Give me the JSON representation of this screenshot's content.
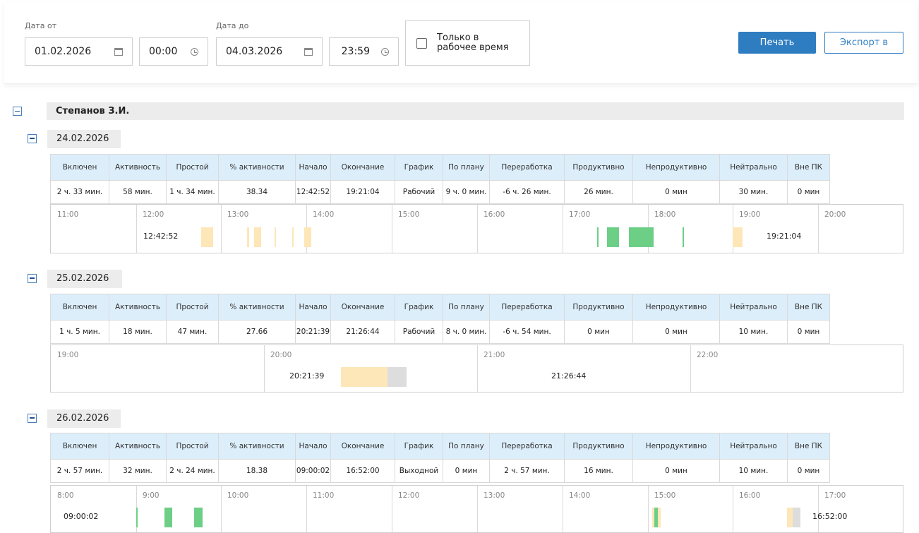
{
  "filters": {
    "date_from_label": "Дата от",
    "date_from": "01.02.2026",
    "time_from": "00:00",
    "date_to_label": "Дата до",
    "date_to": "04.03.2026",
    "time_to": "23:59",
    "work_time_only_label_line1": "Только в",
    "work_time_only_label_line2": "рабочее время",
    "work_time_only_checked": false,
    "print_label": "Печать",
    "export_label": "Экспорт в"
  },
  "colors": {
    "accent": "#2f7dc1",
    "header_bg": "#ddeefb",
    "active": "#6dcf86",
    "idle": "#fde7b8",
    "neutral": "#dddddd"
  },
  "person": {
    "name": "Степанов З.И."
  },
  "columns": [
    "Включен",
    "Активность",
    "Простой",
    "% активности",
    "Начало",
    "Окончание",
    "График",
    "По плану",
    "Переработка",
    "Продуктивно",
    "Непродуктивно",
    "Нейтрально",
    "Вне ПК"
  ],
  "days": [
    {
      "date": "24.02.2026",
      "stats": [
        "2 ч. 33 мин.",
        "58 мин.",
        "1 ч. 34 мин.",
        "38.34",
        "12:42:52",
        "19:21:04",
        "Рабочий",
        "9 ч. 0 мин.",
        "-6 ч. 26 мин.",
        "26 мин.",
        "0 мин",
        "30 мин.",
        "0 мин"
      ],
      "timeline": {
        "hours": [
          "11:00",
          "12:00",
          "13:00",
          "14:00",
          "15:00",
          "16:00",
          "17:00",
          "18:00",
          "19:00",
          "20:00"
        ],
        "start_label": "12:42:52",
        "end_label": "19:21:04",
        "segments": [
          {
            "hour": 12.76,
            "len": 0.08,
            "kind": "idle"
          },
          {
            "hour": 12.84,
            "len": 0.06,
            "kind": "idle"
          },
          {
            "hour": 13.3,
            "len": 0.02,
            "kind": "idle"
          },
          {
            "hour": 13.38,
            "len": 0.08,
            "kind": "idle"
          },
          {
            "hour": 13.62,
            "len": 0.01,
            "kind": "idle"
          },
          {
            "hour": 13.83,
            "len": 0.01,
            "kind": "idle"
          },
          {
            "hour": 13.97,
            "len": 0.08,
            "kind": "idle"
          },
          {
            "hour": 17.4,
            "len": 0.01,
            "kind": "active"
          },
          {
            "hour": 17.51,
            "len": 0.14,
            "kind": "active"
          },
          {
            "hour": 17.77,
            "len": 0.29,
            "kind": "active"
          },
          {
            "hour": 18.4,
            "len": 0.01,
            "kind": "active"
          },
          {
            "hour": 18.98,
            "len": 0.12,
            "kind": "idle"
          }
        ]
      }
    },
    {
      "date": "25.02.2026",
      "stats": [
        "1 ч. 5 мин.",
        "18 мин.",
        "47 мин.",
        "27.66",
        "20:21:39",
        "21:26:44",
        "Рабочий",
        "8 ч. 0 мин.",
        "-6 ч. 54 мин.",
        "0 мин",
        "0 мин",
        "10 мин.",
        "0 мин"
      ],
      "timeline": {
        "hours": [
          "19:00",
          "20:00",
          "21:00",
          "22:00"
        ],
        "start_label": "20:21:39",
        "end_label": "21:26:44",
        "segments": [
          {
            "hour": 20.36,
            "len": 0.22,
            "kind": "idle"
          },
          {
            "hour": 20.58,
            "len": 0.09,
            "kind": "neutral"
          }
        ]
      }
    },
    {
      "date": "26.02.2026",
      "stats": [
        "2 ч. 57 мин.",
        "32 мин.",
        "2 ч. 24 мин.",
        "18.38",
        "09:00:02",
        "16:52:00",
        "Выходной",
        "0 мин",
        "2 ч. 57 мин.",
        "16 мин.",
        "0 мин",
        "10 мин.",
        "0 мин"
      ],
      "timeline": {
        "hours": [
          "8:00",
          "9:00",
          "10:00",
          "11:00",
          "12:00",
          "13:00",
          "14:00",
          "15:00",
          "16:00",
          "17:00"
        ],
        "start_label": "09:00:02",
        "end_label": "16:52:00",
        "segments": [
          {
            "hour": 9.0,
            "len": 0.01,
            "kind": "active"
          },
          {
            "hour": 9.33,
            "len": 0.09,
            "kind": "active"
          },
          {
            "hour": 9.68,
            "len": 0.1,
            "kind": "active"
          },
          {
            "hour": 15.04,
            "len": 0.03,
            "kind": "idle"
          },
          {
            "hour": 15.07,
            "len": 0.04,
            "kind": "active"
          },
          {
            "hour": 15.11,
            "len": 0.03,
            "kind": "idle"
          },
          {
            "hour": 16.62,
            "len": 0.07,
            "kind": "idle"
          },
          {
            "hour": 16.69,
            "len": 0.09,
            "kind": "neutral"
          }
        ]
      }
    }
  ]
}
